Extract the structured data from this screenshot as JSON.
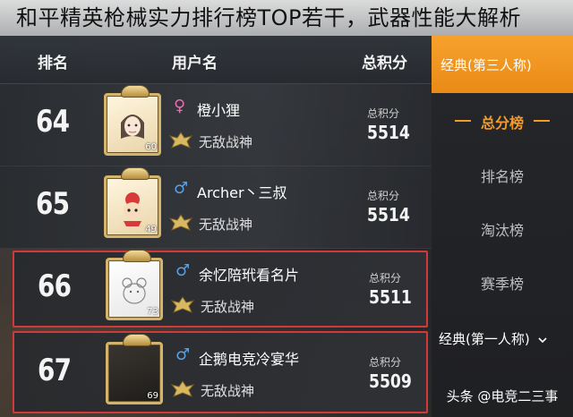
{
  "title": "和平精英枪械实力排行榜TOP若干，武器性能大解析",
  "header": {
    "rank": "排名",
    "user": "用户名",
    "score": "总积分"
  },
  "rows": [
    {
      "rank": "64",
      "gender_symbol": "♀",
      "gender": "female",
      "name": "橙小狸",
      "badge_title": "无敌战神",
      "score_label": "总积分",
      "score": "5514",
      "level": "60",
      "highlighted": false
    },
    {
      "rank": "65",
      "gender_symbol": "♂",
      "gender": "male",
      "name": "Archer丶三叔",
      "badge_title": "无敌战神",
      "score_label": "总积分",
      "score": "5514",
      "level": "49",
      "highlighted": false
    },
    {
      "rank": "66",
      "gender_symbol": "♂",
      "gender": "male",
      "name": "余忆陪玳看名片",
      "badge_title": "无敌战神",
      "score_label": "总积分",
      "score": "5511",
      "level": "73",
      "highlighted": true
    },
    {
      "rank": "67",
      "gender_symbol": "♂",
      "gender": "male",
      "name": "企鹅电竞冷宴华",
      "badge_title": "无敌战神",
      "score_label": "总积分",
      "score": "5509",
      "level": "69",
      "highlighted": true
    }
  ],
  "sidebar": {
    "mode_tab": "经典(第三人称)",
    "items": [
      "总分榜",
      "排名榜",
      "淘汰榜",
      "赛季榜"
    ],
    "active_index": 0,
    "mode_tab2": "经典(第一人称)",
    "mode_tab2_icon": "chevron-down-icon",
    "source": "头条 @电竞二三事"
  },
  "colors": {
    "accent": "#f39a29",
    "highlight_border": "#d2393a",
    "female": "#f06ab0",
    "male": "#5aa0e6"
  }
}
